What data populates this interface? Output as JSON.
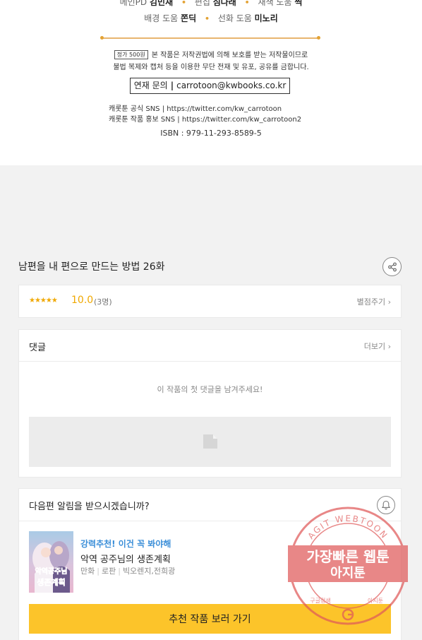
{
  "credits": {
    "line1": [
      {
        "role": "메인PD",
        "name": "김민재"
      },
      {
        "role": "편집",
        "name": "심나래"
      },
      {
        "role": "채색 도움",
        "name": "찍"
      }
    ],
    "line2": [
      {
        "role": "배경 도움",
        "name": "쫀딕"
      },
      {
        "role": "선화 도움",
        "name": "미노리"
      }
    ],
    "price_tag": "정가 500원",
    "notice_line1": "본 작품은 저작권법에 의해 보호를 받는 저작물이므로",
    "notice_line2": "불법 복제와 캡처 등을 이용한 무단 전재 및 유포, 공유를 금합니다.",
    "contact_label": "연재 문의",
    "contact_sep": "|",
    "contact_email": "carrotoon@kwbooks.co.kr",
    "sns1": "캐롯툰 공식 SNS | https://twitter.com/kw_carrotoon",
    "sns2": "캐롯툰 작품 홍보 SNS | https://twitter.com/kw_carrotoon2",
    "isbn": "ISBN : 979-11-293-8589-5"
  },
  "episode": {
    "title": "남편을 내 편으로 만드는 방법 26화",
    "share_icon": "share-icon"
  },
  "rating": {
    "stars": "★★★★★",
    "score": "10.0",
    "count": "(3명)",
    "rate_label": "별점주기 ›"
  },
  "comments": {
    "title": "댓글",
    "more_label": "더보기 ›",
    "empty_message": "이 작품의 첫 댓글을 남겨주세요!"
  },
  "notify": {
    "question": "다음편 알림을 받으시겠습니까?",
    "bell_icon": "bell-icon"
  },
  "recommendation": {
    "tag": "강력추천! 이건 꼭 봐야해",
    "title": "악역 공주님의 생존계획",
    "meta": [
      "만화",
      "로판",
      "빅오렌지,전희광"
    ],
    "cover_text_top": "악역공주님",
    "cover_text_bottom": "생존계획",
    "button_label": "추천 작품 보러 가기"
  },
  "watermark": {
    "arc_text": "AGIT WEBTOON",
    "line1": "가장빠른 웹툰",
    "line2": "아지툰",
    "bottom_left": "구글검색",
    "bottom_right": "아지툰",
    "color": "#e05a5a"
  },
  "colors": {
    "accent_yellow": "#fcc42a",
    "star_orange": "#f0a800",
    "tag_blue": "#3a8ed8"
  }
}
